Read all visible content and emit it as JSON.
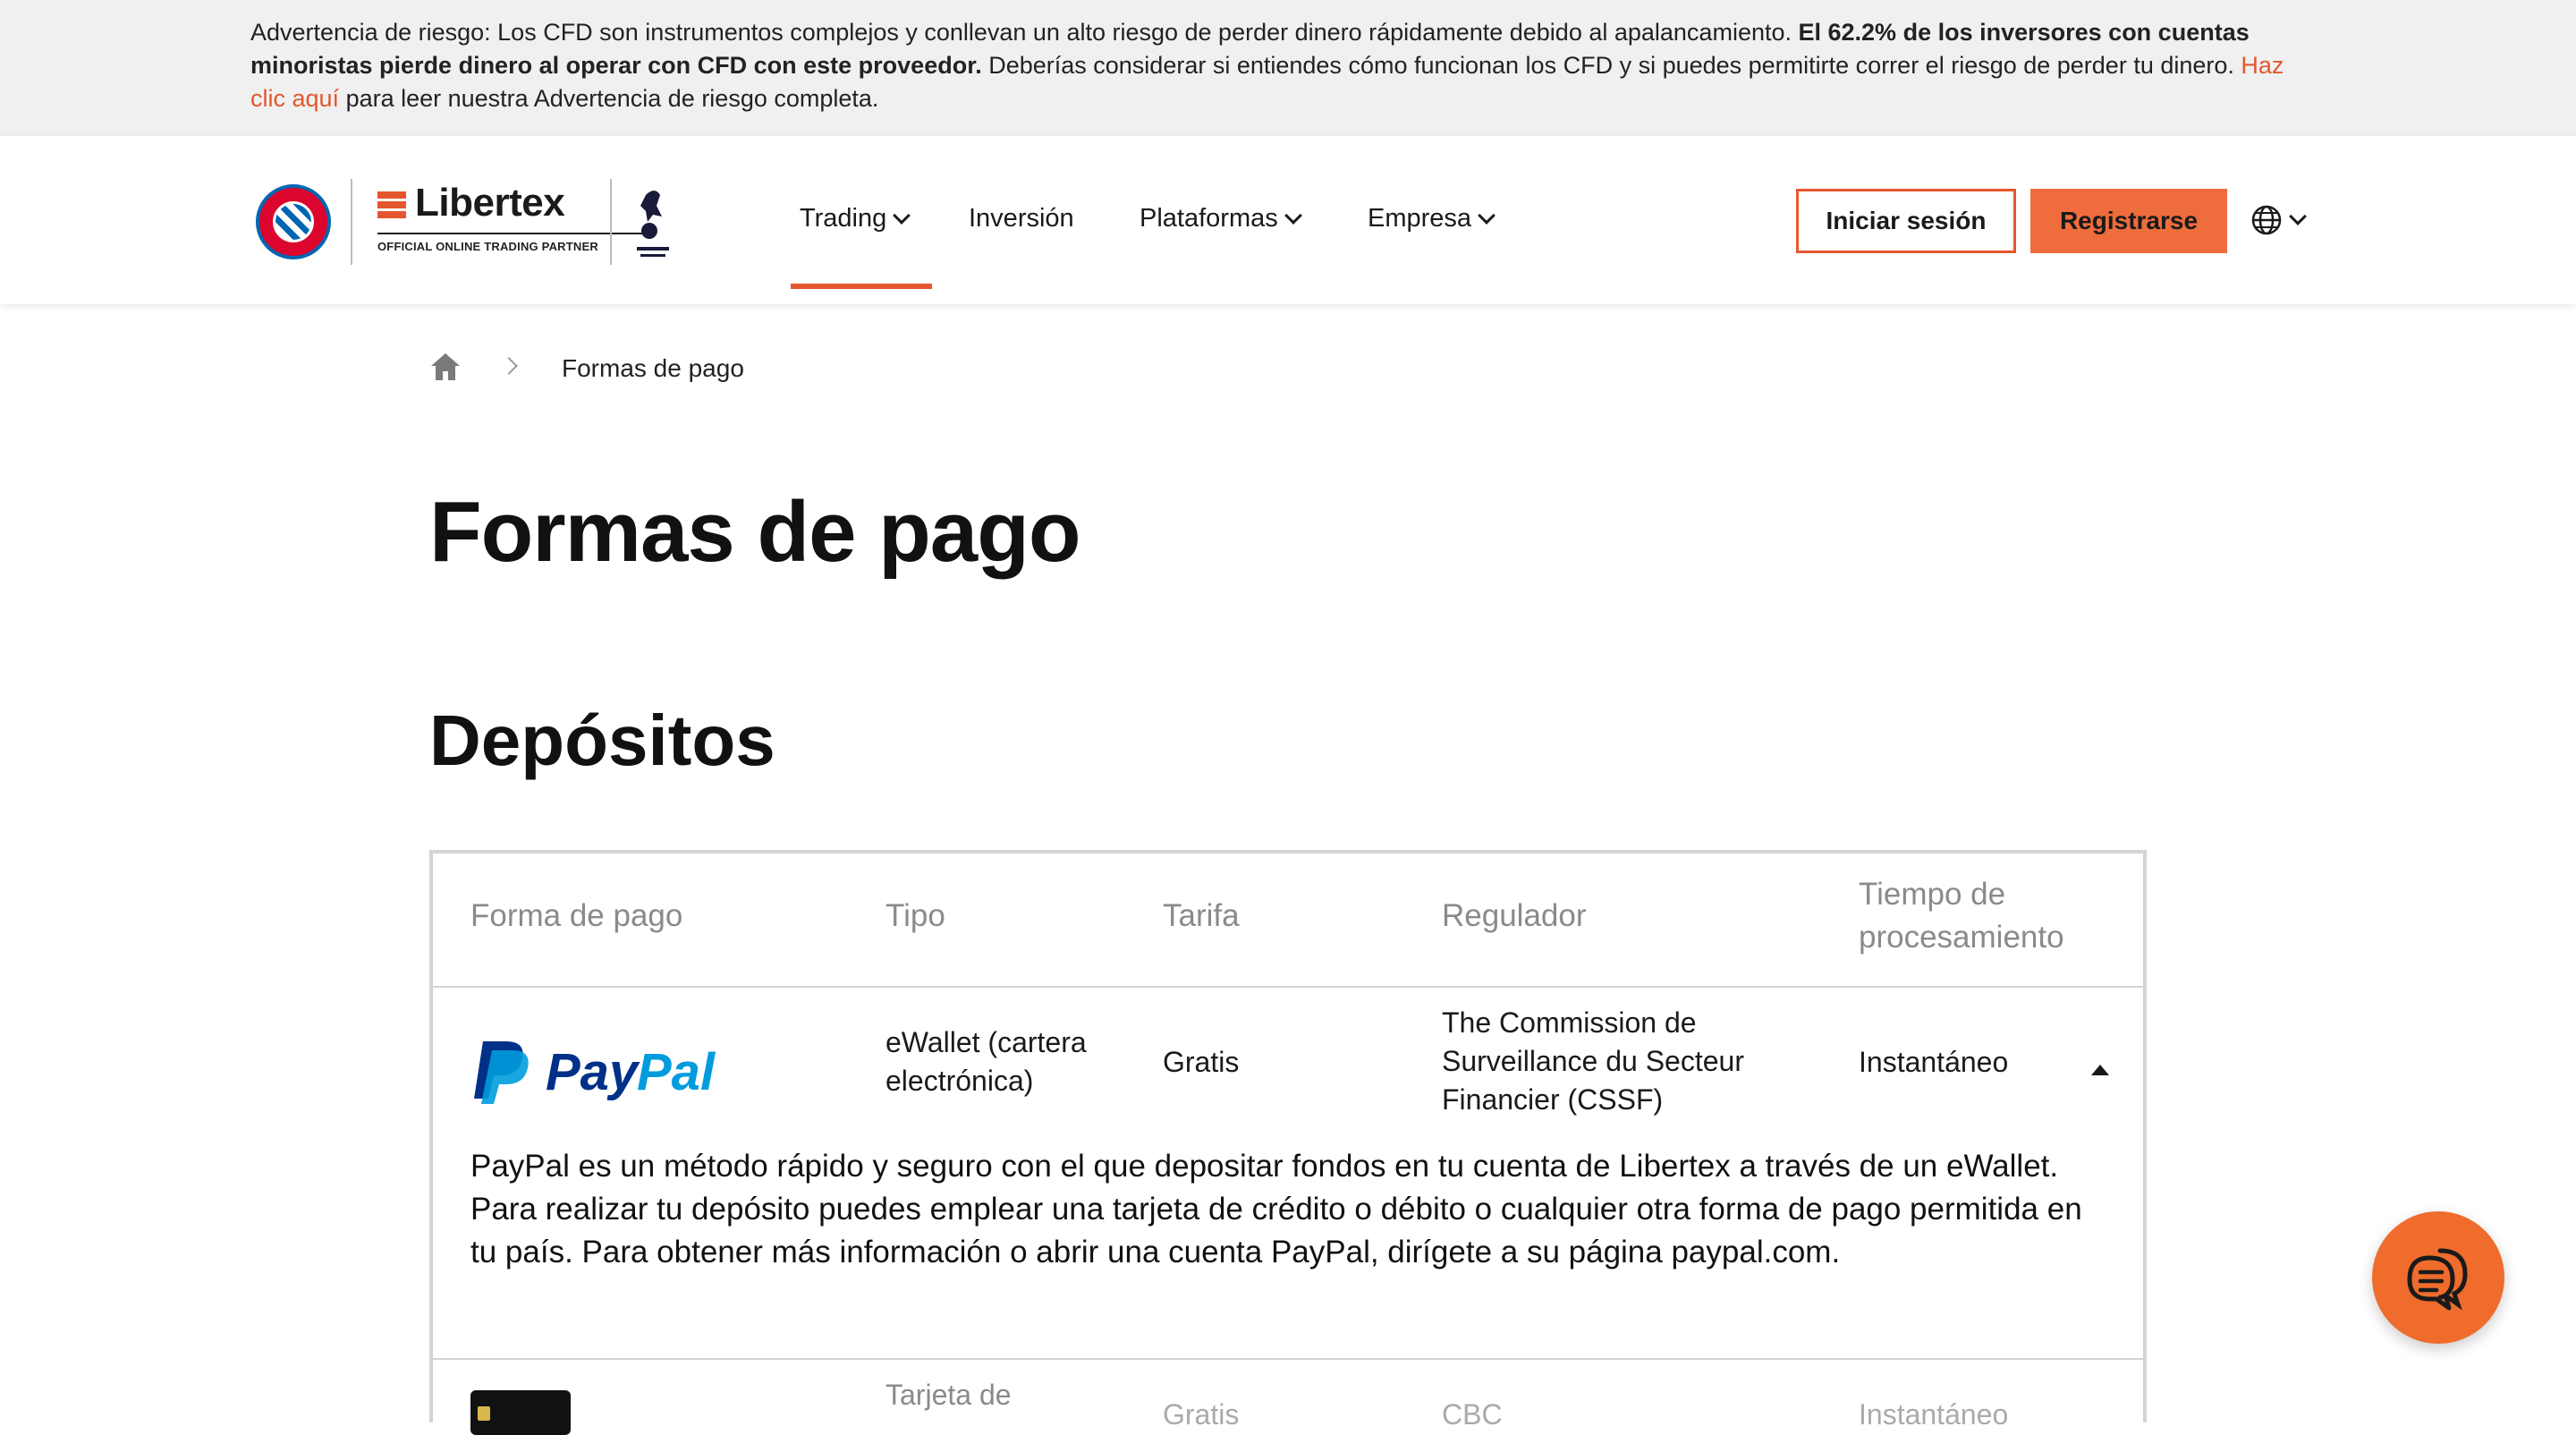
{
  "risk_warning": {
    "part1": "Advertencia de riesgo: Los CFD son instrumentos complejos y conllevan un alto riesgo de perder dinero rápidamente debido al apalancamiento. ",
    "bold": "El 62.2% de los inversores con cuentas minoristas pierde dinero al operar con CFD con este proveedor.",
    "part2": " Deberías considerar si entiendes cómo funcionan los CFD y si puedes permitirte correr el riesgo de perder tu dinero. ",
    "link": "Haz clic aquí",
    "part3": " para leer nuestra Advertencia de riesgo completa."
  },
  "header": {
    "brand": "Libertex",
    "tagline": "OFFICIAL ONLINE TRADING PARTNER",
    "nav": [
      "Trading",
      "Inversión",
      "Plataformas",
      "Empresa"
    ],
    "login_label": "Iniciar sesión",
    "register_label": "Registrarse",
    "accent_color": "#e4572e"
  },
  "breadcrumb": {
    "current": "Formas de pago"
  },
  "page_title": "Formas de pago",
  "section_title": "Depósitos",
  "table": {
    "headers": [
      "Forma de pago",
      "Tipo",
      "Tarifa",
      "Regulador",
      "Tiempo de procesamiento"
    ],
    "rows": [
      {
        "method": "PayPal",
        "type": "eWallet (cartera electrónica)",
        "fee": "Gratis",
        "regulator": "The Commission de Surveillance du Secteur Financier (CSSF)",
        "time": "Instantáneo",
        "description": "PayPal es un método rápido y seguro con el que depositar fondos en tu cuenta de Libertex a través de un eWallet. Para realizar tu depósito puedes emplear una tarjeta de crédito o débito o cualquier otra forma de pago permitida en tu país. Para obtener más información o abrir una cuenta PayPal, dirígete a su página paypal.com."
      },
      {
        "type": "Tarjeta de",
        "fee": "Gratis",
        "regulator": "CBC",
        "time": "Instantáneo"
      }
    ]
  }
}
